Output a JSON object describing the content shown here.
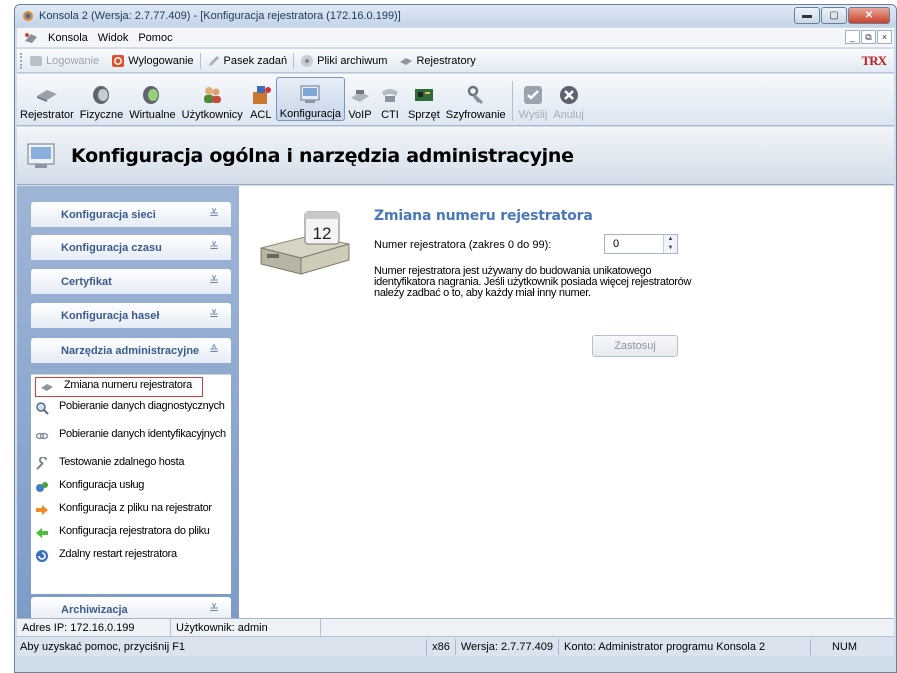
{
  "window": {
    "title": "Konsola 2 (Wersja:  2.7.77.409) - [Konfiguracja rejestratora (172.16.0.199)]"
  },
  "menu": [
    "Konsola",
    "Widok",
    "Pomoc"
  ],
  "quickbar": {
    "login": "Logowanie",
    "logout": "Wylogowanie",
    "taskbar": "Pasek zadań",
    "archive": "Pliki archiwum",
    "recorders": "Rejestratory",
    "brand": "TRX"
  },
  "toolbar": [
    {
      "label": "Rejestrator",
      "icon": "recorder-icon"
    },
    {
      "label": "Fizyczne",
      "icon": "physical-channels-icon"
    },
    {
      "label": "Wirtualne",
      "icon": "virtual-channels-icon"
    },
    {
      "label": "Użytkownicy",
      "icon": "users-icon"
    },
    {
      "label": "ACL",
      "icon": "acl-icon"
    },
    {
      "label": "Konfiguracja",
      "icon": "configuration-icon"
    },
    {
      "label": "VoIP",
      "icon": "voip-icon"
    },
    {
      "label": "CTI",
      "icon": "cti-icon"
    },
    {
      "label": "Sprzęt",
      "icon": "hardware-icon"
    },
    {
      "label": "Szyfrowanie",
      "icon": "encryption-icon"
    },
    {
      "label": "Wyślij",
      "icon": "send-icon"
    },
    {
      "label": "Anuluj",
      "icon": "cancel-icon"
    }
  ],
  "header": {
    "title": "Konfiguracja ogólna i narzędzia administracyjne"
  },
  "sidebar": {
    "panels": [
      "Konfiguracja sieci",
      "Konfiguracja czasu",
      "Certyfikat",
      "Konfiguracja haseł",
      "Narzędzia administracyjne",
      "Archiwizacja"
    ],
    "chevron_down": "≚",
    "chevron_up": "≙",
    "tasks": [
      "Zmiana numeru rejestratora",
      "Pobieranie danych diagnostycznych",
      "Pobieranie danych identyfikacyjnych",
      "Testowanie zdalnego hosta",
      "Konfiguracja usług",
      "Konfiguracja z pliku na rejestrator",
      "Konfiguracja rejestratora do pliku",
      "Zdalny restart rejestratora"
    ]
  },
  "content": {
    "title": "Zmiana numeru rejestratora",
    "field_label": "Numer rejestratora (zakres 0 do 99):",
    "field_value": "0",
    "calendar_day": "12",
    "description": "Numer rejestratora jest używany do budowania unikatowego identyfikatora nagrania. Jeśli użytkownik posiada więcej rejestratorów należy zadbać o to, aby każdy miał inny numer.",
    "apply_label": "Zastosuj"
  },
  "status": {
    "ip": "Adres IP: 172.16.0.199",
    "user": "Użytkownik: admin",
    "help": "Aby uzyskać pomoc, przyciśnij F1",
    "arch": "x86",
    "version": "Wersja: 2.7.77.409",
    "account": "Konto: Administrator programu Konsola 2",
    "num": "NUM"
  }
}
